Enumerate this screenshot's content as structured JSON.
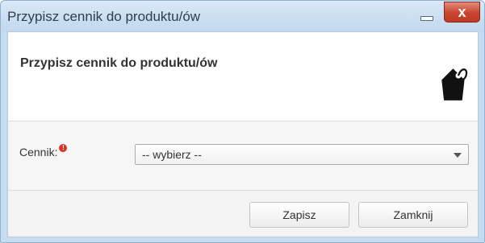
{
  "window": {
    "title": "Przypisz cennik do produktu/ów",
    "close_glyph": "x"
  },
  "header": {
    "title": "Przypisz cennik do produktu/ów",
    "icon": "price-tag-icon"
  },
  "form": {
    "label": "Cennik:",
    "required_mark": "!",
    "select": {
      "selected": "-- wybierz --"
    }
  },
  "footer": {
    "save_label": "Zapisz",
    "close_label": "Zamknij"
  }
}
